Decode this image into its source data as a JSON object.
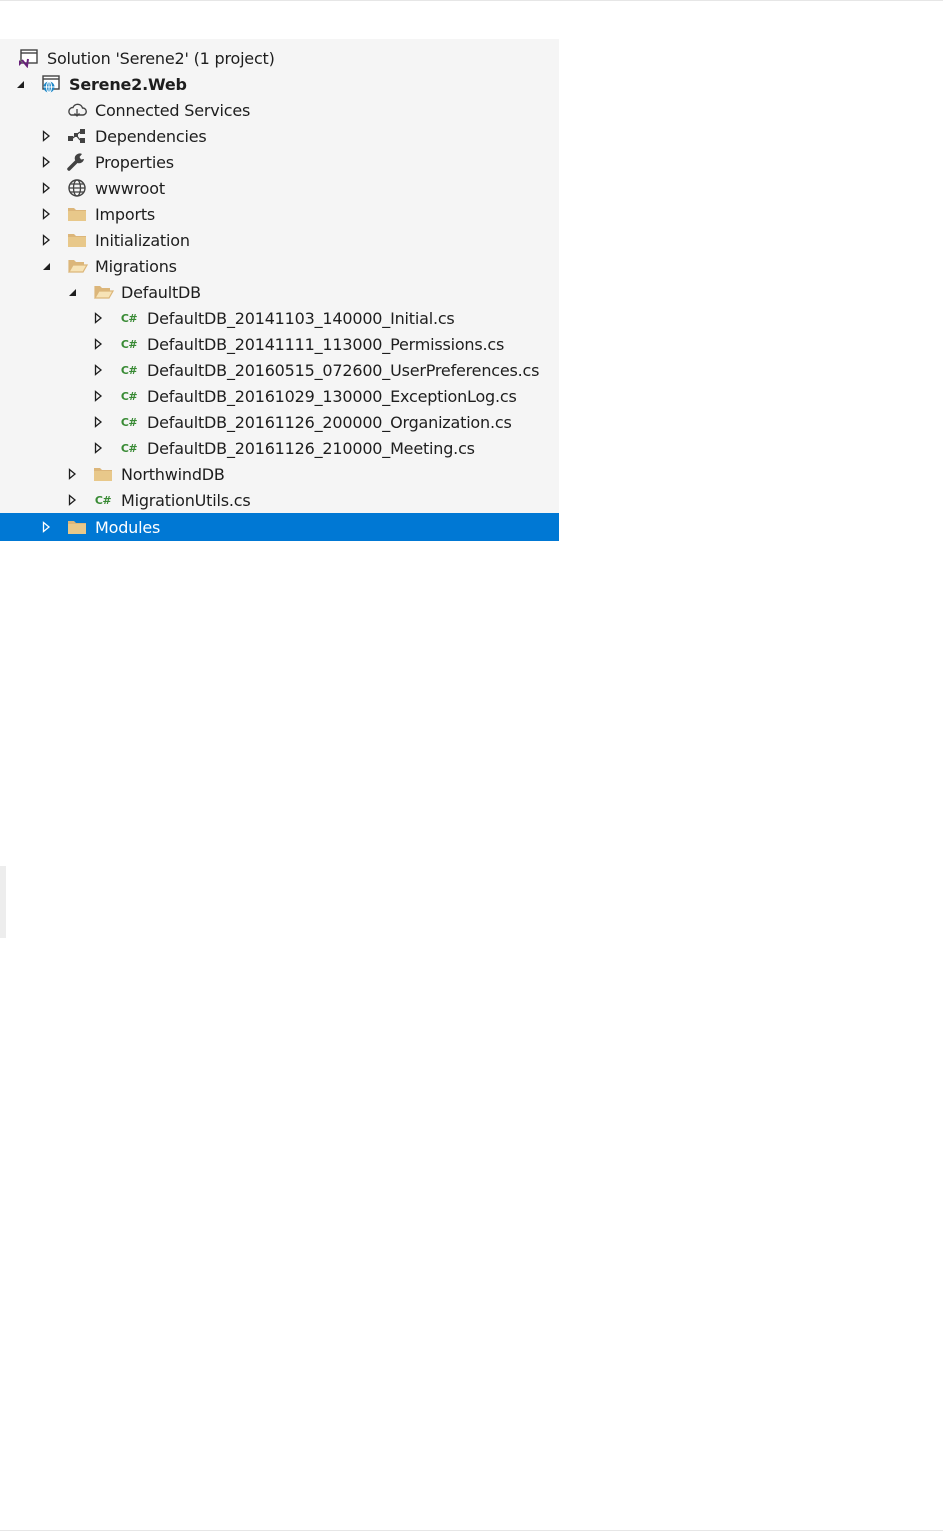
{
  "solution_explorer": {
    "items": [
      {
        "label": "Solution 'Serene2' (1 project)",
        "icon": "solution-icon",
        "expander": "none",
        "depth": 0
      },
      {
        "label": "Serene2.Web",
        "icon": "web-project-icon",
        "expander": "expanded",
        "depth": 0,
        "bold": true
      },
      {
        "label": "Connected Services",
        "icon": "cloud-services-icon",
        "expander": "none",
        "depth": 1
      },
      {
        "label": "Dependencies",
        "icon": "dependencies-icon",
        "expander": "collapsed",
        "depth": 1
      },
      {
        "label": "Properties",
        "icon": "wrench-icon",
        "expander": "collapsed",
        "depth": 1
      },
      {
        "label": "wwwroot",
        "icon": "globe-icon",
        "expander": "collapsed",
        "depth": 1
      },
      {
        "label": "Imports",
        "icon": "folder-icon",
        "expander": "collapsed",
        "depth": 1
      },
      {
        "label": "Initialization",
        "icon": "folder-icon",
        "expander": "collapsed",
        "depth": 1
      },
      {
        "label": "Migrations",
        "icon": "open-folder-icon",
        "expander": "expanded",
        "depth": 1
      },
      {
        "label": "DefaultDB",
        "icon": "open-folder-icon",
        "expander": "expanded",
        "depth": 2
      },
      {
        "label": "DefaultDB_20141103_140000_Initial.cs",
        "icon": "csharp-file-icon",
        "expander": "collapsed",
        "depth": 3
      },
      {
        "label": "DefaultDB_20141111_113000_Permissions.cs",
        "icon": "csharp-file-icon",
        "expander": "collapsed",
        "depth": 3
      },
      {
        "label": "DefaultDB_20160515_072600_UserPreferences.cs",
        "icon": "csharp-file-icon",
        "expander": "collapsed",
        "depth": 3
      },
      {
        "label": "DefaultDB_20161029_130000_ExceptionLog.cs",
        "icon": "csharp-file-icon",
        "expander": "collapsed",
        "depth": 3
      },
      {
        "label": "DefaultDB_20161126_200000_Organization.cs",
        "icon": "csharp-file-icon",
        "expander": "collapsed",
        "depth": 3
      },
      {
        "label": "DefaultDB_20161126_210000_Meeting.cs",
        "icon": "csharp-file-icon",
        "expander": "collapsed",
        "depth": 3
      },
      {
        "label": "NorthwindDB",
        "icon": "folder-icon",
        "expander": "collapsed",
        "depth": 2
      },
      {
        "label": "MigrationUtils.cs",
        "icon": "csharp-file-icon",
        "expander": "collapsed",
        "depth": 2
      },
      {
        "label": "Modules",
        "icon": "folder-icon",
        "expander": "collapsed",
        "depth": 1,
        "selected": true
      }
    ]
  },
  "colors": {
    "panel_bg": "#f5f5f5",
    "selection": "#0078d4",
    "folder": "#dcb67a",
    "csharp": "#388a34",
    "vs_purple": "#68217a",
    "web_blue": "#1e88c8"
  }
}
